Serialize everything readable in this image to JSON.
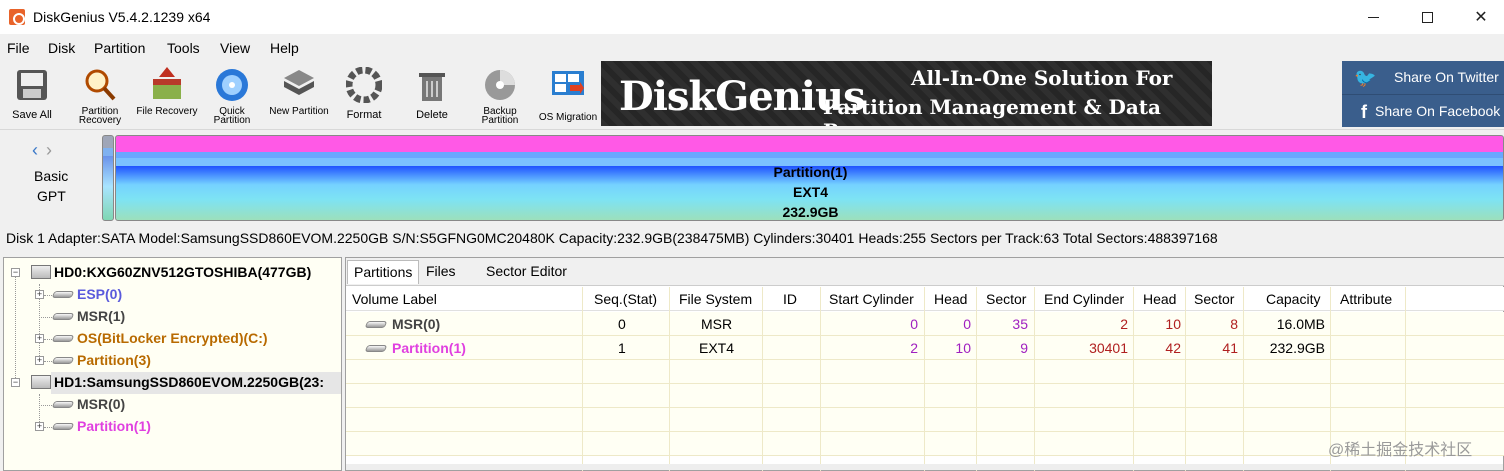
{
  "window": {
    "title": "DiskGenius V5.4.2.1239 x64"
  },
  "menu": [
    "File",
    "Disk",
    "Partition",
    "Tools",
    "View",
    "Help"
  ],
  "toolbar": [
    {
      "label": "Save All",
      "icon": "save-all-icon"
    },
    {
      "label": "Partition Recovery",
      "icon": "partition-recovery-icon"
    },
    {
      "label": "File Recovery",
      "icon": "file-recovery-icon"
    },
    {
      "label": "Quick Partition",
      "icon": "quick-partition-icon"
    },
    {
      "label": "New Partition",
      "icon": "new-partition-icon"
    },
    {
      "label": "Format",
      "icon": "format-icon"
    },
    {
      "label": "Delete",
      "icon": "delete-icon"
    },
    {
      "label": "Backup Partition",
      "icon": "backup-partition-icon"
    },
    {
      "label": "OS Migration",
      "icon": "os-migration-icon"
    }
  ],
  "banner": {
    "logo": "DiskGenius",
    "line1": "All-In-One Solution For",
    "line2": "Partition Management & Data Recovery"
  },
  "social": {
    "twitter": "Share On Twitter",
    "facebook": "Share On Facebook"
  },
  "diskmap": {
    "type_line1": "Basic",
    "type_line2": "GPT",
    "partition_name": "Partition(1)",
    "partition_fs": "EXT4",
    "partition_size": "232.9GB",
    "colors": {
      "partition": "#ff59e6",
      "used": "#1f52ff"
    }
  },
  "disk_info": "Disk 1 Adapter:SATA  Model:SamsungSSD860EVOM.2250GB  S/N:S5GFNG0MC20480K  Capacity:232.9GB(238475MB)  Cylinders:30401  Heads:255  Sectors per Track:63  Total Sectors:488397168",
  "tree": {
    "hd0": "HD0:KXG60ZNV512GTOSHIBA(477GB)",
    "hd0_parts": [
      {
        "label": "ESP(0)",
        "color": "#5a5adc"
      },
      {
        "label": "MSR(1)",
        "color": "#444444"
      },
      {
        "label": "OS(BitLocker Encrypted)(C:)",
        "color": "#b86a00"
      },
      {
        "label": "Partition(3)",
        "color": "#b86a00"
      }
    ],
    "hd1": "HD1:SamsungSSD860EVOM.2250GB(23:",
    "hd1_parts": [
      {
        "label": "MSR(0)",
        "color": "#444444"
      },
      {
        "label": "Partition(1)",
        "color": "#e040e0"
      }
    ]
  },
  "tabs": [
    "Partitions",
    "Files",
    "Sector Editor"
  ],
  "columns": [
    "Volume Label",
    "Seq.(Stat)",
    "File System",
    "ID",
    "Start Cylinder",
    "Head",
    "Sector",
    "End Cylinder",
    "Head",
    "Sector",
    "Capacity",
    "Attribute"
  ],
  "rows": [
    {
      "label": "MSR(0)",
      "seq": "0",
      "fs": "MSR",
      "id": "",
      "start_cyl": "0",
      "head1": "0",
      "sector1": "35",
      "end_cyl": "2",
      "head2": "10",
      "sector2": "8",
      "capacity": "16.0MB",
      "attribute": "",
      "label_color": "#444444"
    },
    {
      "label": "Partition(1)",
      "seq": "1",
      "fs": "EXT4",
      "id": "",
      "start_cyl": "2",
      "head1": "10",
      "sector1": "9",
      "end_cyl": "30401",
      "head2": "42",
      "sector2": "41",
      "capacity": "232.9GB",
      "attribute": "",
      "label_color": "#e040e0"
    }
  ],
  "watermark": "@稀土掘金技术社区"
}
